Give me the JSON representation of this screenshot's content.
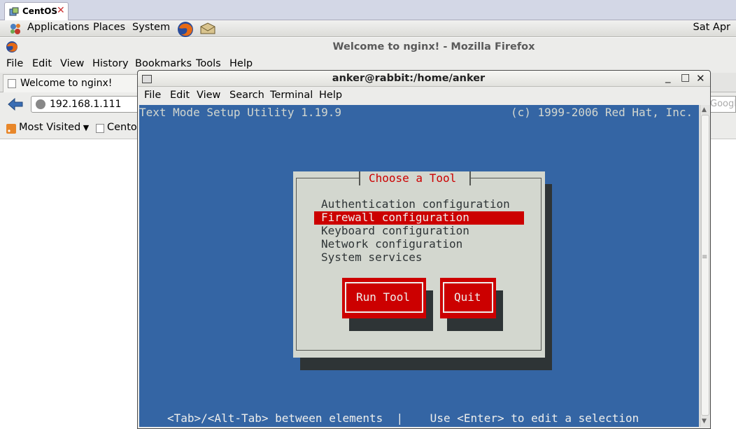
{
  "host": {
    "tab_label": "CentOS",
    "tab_close": "✕"
  },
  "gnome_panel": {
    "menus": [
      "Applications",
      "Places",
      "System"
    ],
    "clock": "Sat Apr"
  },
  "firefox": {
    "window_title": "Welcome to nginx! - Mozilla Firefox",
    "menu": [
      "File",
      "Edit",
      "View",
      "History",
      "Bookmarks",
      "Tools",
      "Help"
    ],
    "tab_title": "Welcome to nginx!",
    "url": "192.168.1.111",
    "search_placeholder": "Google",
    "bookmarks": {
      "most_visited": "Most Visited",
      "centos": "Centos"
    }
  },
  "terminal": {
    "window_title": "anker@rabbit:/home/anker",
    "controls": {
      "minimize": "_",
      "maximize": "□",
      "close": "✕"
    },
    "menu": [
      "File",
      "Edit",
      "View",
      "Search",
      "Terminal",
      "Help"
    ],
    "screen": {
      "header_left": "Text Mode Setup Utility 1.19.9",
      "header_right": "(c) 1999-2006 Red Hat, Inc.",
      "footer": "<Tab>/<Alt-Tab> between elements  |    Use <Enter> to edit a selection",
      "dialog": {
        "title": "Choose a Tool",
        "items": [
          "Authentication configuration",
          "Firewall configuration",
          "Keyboard configuration",
          "Network configuration",
          "System services"
        ],
        "selected_index": 1,
        "buttons": {
          "run": "Run Tool",
          "quit": "Quit"
        }
      }
    }
  },
  "colors": {
    "terminal_bg": "#3465a4",
    "dialog_bg": "#d3d7cf",
    "accent_red": "#cc0000",
    "shadow": "#2e3436"
  }
}
